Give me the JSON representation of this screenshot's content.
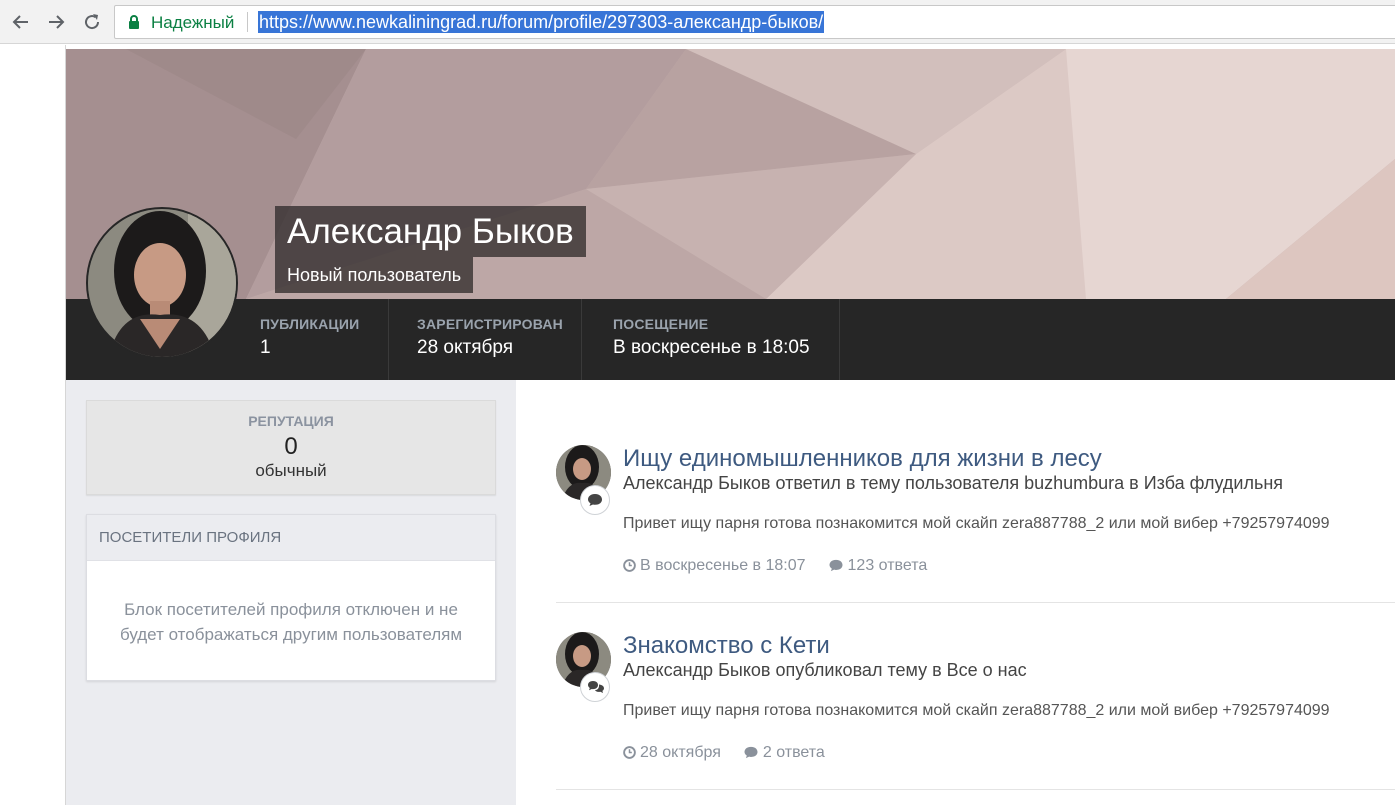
{
  "browser": {
    "secure_label": "Надежный",
    "url": "https://www.newkaliningrad.ru/forum/profile/297303-александр-быков/"
  },
  "profile": {
    "name": "Александр Быков",
    "group": "Новый пользователь",
    "stats": [
      {
        "label": "ПУБЛИКАЦИИ",
        "value": "1"
      },
      {
        "label": "ЗАРЕГИСТРИРОВАН",
        "value": "28 октября"
      },
      {
        "label": "ПОСЕЩЕНИЕ",
        "value": "В воскресенье в 18:05"
      }
    ]
  },
  "sidebar": {
    "reputation": {
      "title": "РЕПУТАЦИЯ",
      "value": "0",
      "level": "обычный"
    },
    "visitors": {
      "title": "ПОСЕТИТЕЛИ ПРОФИЛЯ",
      "message_line1": "Блок посетителей профиля отключен и не",
      "message_line2": "будет отображаться другим пользователям"
    }
  },
  "feed": [
    {
      "title": "Ищу единомышленников для жизни в лесу",
      "meta": "Александр Быков ответил в тему пользователя buzhumbura в Изба флудильня",
      "text": "Привет ищу парня готова познакомится мой скайп zera887788_2 или мой вибер +79257974099",
      "date": "В воскресенье в 18:07",
      "replies": "123 ответа"
    },
    {
      "title": "Знакомство с Кети",
      "meta": "Александр Быков опубликовал тему в Все о нас",
      "text": "Привет ищу парня готова познакомится мой скайп zera887788_2 или мой вибер +79257974099",
      "date": "28 октября",
      "replies": "2 ответа"
    }
  ],
  "colors": {
    "stats_bar": "#262626",
    "link": "#3e5a80",
    "sidebar_bg": "#ebecf0",
    "secure_green": "#0b8043",
    "url_selection": "#3875d7"
  },
  "icons": [
    "back-arrow-icon",
    "forward-arrow-icon",
    "reload-icon",
    "lock-icon",
    "comment-icon",
    "clock-icon",
    "comment-bubble-icon"
  ]
}
